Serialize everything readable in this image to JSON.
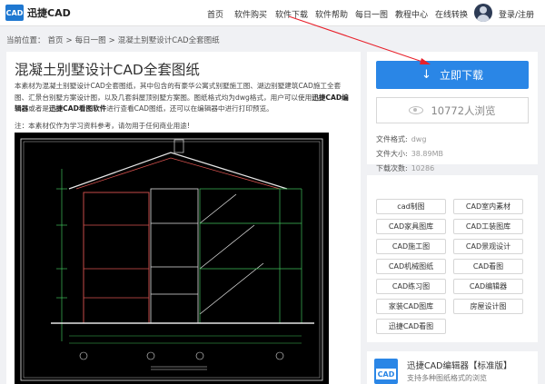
{
  "header": {
    "logo_mark": "CAD",
    "logo_text": "迅捷CAD",
    "nav": [
      "首页",
      "软件购买",
      "软件下载",
      "软件帮助",
      "每日一图",
      "教程中心",
      "在线转换"
    ],
    "login": "登录/注册"
  },
  "breadcrumb": {
    "prefix": "当前位置：",
    "items": [
      "首页",
      "每日一图",
      "混凝土别墅设计CAD全套图纸"
    ],
    "separator": ">"
  },
  "main": {
    "title": "混凝土别墅设计CAD全套图纸",
    "desc_part1": "本素材为混凝土别墅设计CAD全套图纸，其中包含的有豪华公寓式别墅施工图、湖边别墅建筑CAD施工全套图、汇景台别墅方案设计图，以及几套斜屋顶别墅方案图。图纸格式均为dwg格式，用户可以使用",
    "desc_bold1": "迅捷CAD编辑器",
    "desc_part2": "或者是",
    "desc_bold2": "迅捷CAD看图软件",
    "desc_part3": "进行查看CAD图纸，还可以在编辑器中进行打印预览。",
    "note": "注：本素材仅作为学习资料参考，请勿用于任何商业用途!"
  },
  "side": {
    "download_label": "立即下载",
    "views_label": "10772人浏览",
    "format_label": "文件格式:",
    "format_value": "dwg",
    "size_label": "文件大小:",
    "size_value": "38.89MB",
    "downloads_label": "下载次数:",
    "downloads_value": "10286"
  },
  "tags": [
    "cad制图",
    "CAD室内素材",
    "CAD家具图库",
    "CAD工装图库",
    "CAD施工图",
    "CAD景观设计",
    "CAD机械图纸",
    "CAD看图",
    "CAD练习图",
    "CAD编辑器",
    "家装CAD图库",
    "房屋设计图",
    "迅捷CAD看图"
  ],
  "product": {
    "icon_text": "CAD",
    "name": "迅捷CAD编辑器【标准版】",
    "desc": "支持多种图纸格式的浏览"
  },
  "colors": {
    "accent": "#2a86e6",
    "annotation_arrow": "#e8212b",
    "drawing_background": "#000000"
  }
}
